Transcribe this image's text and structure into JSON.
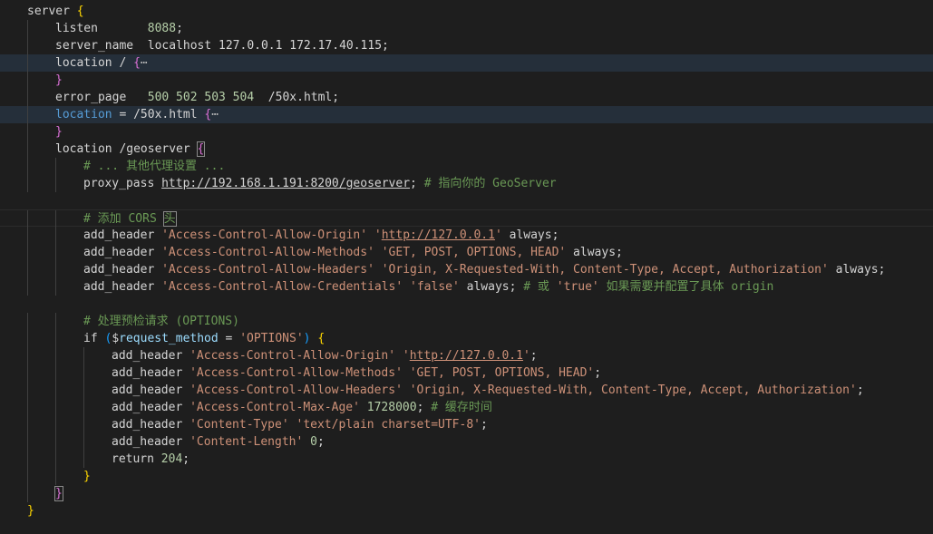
{
  "editor": {
    "lines": [
      {
        "indent": 0,
        "parts": [
          {
            "t": "server ",
            "c": "k"
          },
          {
            "t": "{",
            "c": "b1"
          }
        ]
      },
      {
        "indent": 1,
        "parts": [
          {
            "t": "listen       ",
            "c": "k"
          },
          {
            "t": "8088",
            "c": "n"
          },
          {
            "t": ";",
            "c": "k"
          }
        ]
      },
      {
        "indent": 1,
        "parts": [
          {
            "t": "server_name  localhost 127.0.0.1 172.17.40.115;",
            "c": "k"
          }
        ]
      },
      {
        "indent": 1,
        "hl": true,
        "parts": [
          {
            "t": "location / ",
            "c": "k"
          },
          {
            "t": "{",
            "c": "b2"
          },
          {
            "t": "⋯",
            "c": "fold"
          }
        ]
      },
      {
        "indent": 1,
        "parts": [
          {
            "t": "}",
            "c": "b2"
          }
        ]
      },
      {
        "indent": 1,
        "parts": [
          {
            "t": "error_page   ",
            "c": "k"
          },
          {
            "t": "500 502 503 504",
            "c": "n"
          },
          {
            "t": "  /50x.html;",
            "c": "k"
          }
        ]
      },
      {
        "indent": 1,
        "hl": true,
        "parts": [
          {
            "t": "location",
            "c": "kw"
          },
          {
            "t": " = /50x.html ",
            "c": "k"
          },
          {
            "t": "{",
            "c": "b2"
          },
          {
            "t": "⋯",
            "c": "fold"
          }
        ]
      },
      {
        "indent": 1,
        "parts": [
          {
            "t": "}",
            "c": "b2"
          }
        ]
      },
      {
        "indent": 1,
        "parts": [
          {
            "t": "location /geoserver ",
            "c": "k"
          },
          {
            "t": "{",
            "c": "b2",
            "box": true
          }
        ]
      },
      {
        "indent": 2,
        "parts": [
          {
            "t": "# ... 其他代理设置 ...",
            "c": "c"
          }
        ]
      },
      {
        "indent": 2,
        "parts": [
          {
            "t": "proxy_pass ",
            "c": "k"
          },
          {
            "t": "http://192.168.1.191:8200/geoserver",
            "c": "k",
            "u": true
          },
          {
            "t": "; ",
            "c": "k"
          },
          {
            "t": "# 指向你的 GeoServer",
            "c": "c"
          }
        ]
      },
      {
        "indent": 0,
        "parts": []
      },
      {
        "indent": 2,
        "cur": true,
        "parts": [
          {
            "t": "# 添加 CORS ",
            "c": "c"
          },
          {
            "t": "头",
            "c": "c",
            "box": true
          }
        ]
      },
      {
        "indent": 2,
        "parts": [
          {
            "t": "add_header ",
            "c": "k"
          },
          {
            "t": "'Access-Control-Allow-Origin'",
            "c": "s"
          },
          {
            "t": " ",
            "c": "k"
          },
          {
            "t": "'",
            "c": "s"
          },
          {
            "t": "http://127.0.0.1",
            "c": "s",
            "u": true
          },
          {
            "t": "'",
            "c": "s"
          },
          {
            "t": " always;",
            "c": "k"
          }
        ]
      },
      {
        "indent": 2,
        "parts": [
          {
            "t": "add_header ",
            "c": "k"
          },
          {
            "t": "'Access-Control-Allow-Methods'",
            "c": "s"
          },
          {
            "t": " ",
            "c": "k"
          },
          {
            "t": "'GET, POST, OPTIONS, HEAD'",
            "c": "s"
          },
          {
            "t": " always;",
            "c": "k"
          }
        ]
      },
      {
        "indent": 2,
        "parts": [
          {
            "t": "add_header ",
            "c": "k"
          },
          {
            "t": "'Access-Control-Allow-Headers'",
            "c": "s"
          },
          {
            "t": " ",
            "c": "k"
          },
          {
            "t": "'Origin, X-Requested-With, Content-Type, Accept, Authorization'",
            "c": "s"
          },
          {
            "t": " always;",
            "c": "k"
          }
        ]
      },
      {
        "indent": 2,
        "parts": [
          {
            "t": "add_header ",
            "c": "k"
          },
          {
            "t": "'Access-Control-Allow-Credentials'",
            "c": "s"
          },
          {
            "t": " ",
            "c": "k"
          },
          {
            "t": "'false'",
            "c": "s"
          },
          {
            "t": " always; ",
            "c": "k"
          },
          {
            "t": "# 或 ",
            "c": "c"
          },
          {
            "t": "'true'",
            "c": "s"
          },
          {
            "t": " 如果需要并配置了具体 origin",
            "c": "c"
          }
        ]
      },
      {
        "indent": 0,
        "parts": []
      },
      {
        "indent": 2,
        "parts": [
          {
            "t": "# 处理预检请求 (OPTIONS)",
            "c": "c"
          }
        ]
      },
      {
        "indent": 2,
        "parts": [
          {
            "t": "if ",
            "c": "k"
          },
          {
            "t": "(",
            "c": "b3"
          },
          {
            "t": "$",
            "c": "k"
          },
          {
            "t": "request_method",
            "c": "v"
          },
          {
            "t": " = ",
            "c": "k"
          },
          {
            "t": "'OPTIONS'",
            "c": "s"
          },
          {
            "t": ")",
            "c": "b3"
          },
          {
            "t": " ",
            "c": "k"
          },
          {
            "t": "{",
            "c": "b1"
          }
        ]
      },
      {
        "indent": 3,
        "parts": [
          {
            "t": "add_header ",
            "c": "k"
          },
          {
            "t": "'Access-Control-Allow-Origin'",
            "c": "s"
          },
          {
            "t": " ",
            "c": "k"
          },
          {
            "t": "'",
            "c": "s"
          },
          {
            "t": "http://127.0.0.1",
            "c": "s",
            "u": true
          },
          {
            "t": "'",
            "c": "s"
          },
          {
            "t": ";",
            "c": "k"
          }
        ]
      },
      {
        "indent": 3,
        "parts": [
          {
            "t": "add_header ",
            "c": "k"
          },
          {
            "t": "'Access-Control-Allow-Methods'",
            "c": "s"
          },
          {
            "t": " ",
            "c": "k"
          },
          {
            "t": "'GET, POST, OPTIONS, HEAD'",
            "c": "s"
          },
          {
            "t": ";",
            "c": "k"
          }
        ]
      },
      {
        "indent": 3,
        "parts": [
          {
            "t": "add_header ",
            "c": "k"
          },
          {
            "t": "'Access-Control-Allow-Headers'",
            "c": "s"
          },
          {
            "t": " ",
            "c": "k"
          },
          {
            "t": "'Origin, X-Requested-With, Content-Type, Accept, Authorization'",
            "c": "s"
          },
          {
            "t": ";",
            "c": "k"
          }
        ]
      },
      {
        "indent": 3,
        "parts": [
          {
            "t": "add_header ",
            "c": "k"
          },
          {
            "t": "'Access-Control-Max-Age'",
            "c": "s"
          },
          {
            "t": " ",
            "c": "k"
          },
          {
            "t": "1728000",
            "c": "n"
          },
          {
            "t": "; ",
            "c": "k"
          },
          {
            "t": "# 缓存时间",
            "c": "c"
          }
        ]
      },
      {
        "indent": 3,
        "parts": [
          {
            "t": "add_header ",
            "c": "k"
          },
          {
            "t": "'Content-Type'",
            "c": "s"
          },
          {
            "t": " ",
            "c": "k"
          },
          {
            "t": "'text/plain charset=UTF-8'",
            "c": "s"
          },
          {
            "t": ";",
            "c": "k"
          }
        ]
      },
      {
        "indent": 3,
        "parts": [
          {
            "t": "add_header ",
            "c": "k"
          },
          {
            "t": "'Content-Length'",
            "c": "s"
          },
          {
            "t": " ",
            "c": "k"
          },
          {
            "t": "0",
            "c": "n"
          },
          {
            "t": ";",
            "c": "k"
          }
        ]
      },
      {
        "indent": 3,
        "parts": [
          {
            "t": "return ",
            "c": "k"
          },
          {
            "t": "204",
            "c": "n"
          },
          {
            "t": ";",
            "c": "k"
          }
        ]
      },
      {
        "indent": 2,
        "parts": [
          {
            "t": "}",
            "c": "b1"
          }
        ]
      },
      {
        "indent": 1,
        "parts": [
          {
            "t": "}",
            "c": "b2",
            "box": true
          }
        ]
      },
      {
        "indent": 0,
        "parts": [
          {
            "t": "}",
            "c": "b1"
          }
        ]
      }
    ]
  }
}
